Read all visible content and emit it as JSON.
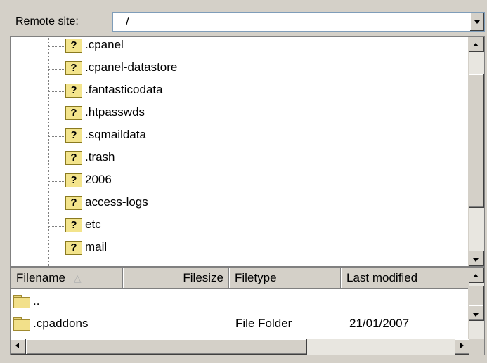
{
  "remote_site": {
    "label": "Remote site:",
    "path": "/"
  },
  "tree": {
    "items": [
      {
        "label": ".cpanel"
      },
      {
        "label": ".cpanel-datastore"
      },
      {
        "label": ".fantasticodata"
      },
      {
        "label": ".htpasswds"
      },
      {
        "label": ".sqmaildata"
      },
      {
        "label": ".trash"
      },
      {
        "label": "2006"
      },
      {
        "label": "access-logs"
      },
      {
        "label": "etc"
      },
      {
        "label": "mail"
      }
    ],
    "item_icon": "unknown-folder-question-icon"
  },
  "file_list": {
    "columns": [
      {
        "label": "Filename",
        "sort": "ascending"
      },
      {
        "label": "Filesize"
      },
      {
        "label": "Filetype"
      },
      {
        "label": "Last modified"
      }
    ],
    "rows": [
      {
        "name": "..",
        "size": "",
        "type": "",
        "modified": ""
      },
      {
        "name": ".cpaddons",
        "size": "",
        "type": "File Folder",
        "modified": "21/01/2007"
      }
    ],
    "sort_glyph": "△"
  },
  "colors": {
    "window_bg": "#d4d0c8",
    "panel_bg": "#ffffff",
    "folder": "#f2e08a"
  }
}
